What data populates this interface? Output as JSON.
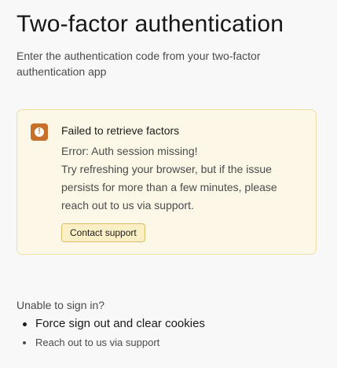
{
  "header": {
    "title": "Two-factor authentication",
    "subtitle": "Enter the authentication code from your two-factor authentication app"
  },
  "alert": {
    "icon": "warning-icon",
    "icon_glyph": "!",
    "accent_color": "#c7702a",
    "background_color": "#fdf7e8",
    "title": "Failed to retrieve factors",
    "error_line": "Error: Auth session missing!",
    "message_lines": [
      "Try refreshing your browser, but if the issue",
      "persists for more than a few minutes, please",
      "reach out to us via support."
    ],
    "button_label": "Contact support"
  },
  "help": {
    "heading": "Unable to sign in?",
    "items": [
      "Force sign out and clear cookies",
      "Reach out to us via support"
    ]
  }
}
